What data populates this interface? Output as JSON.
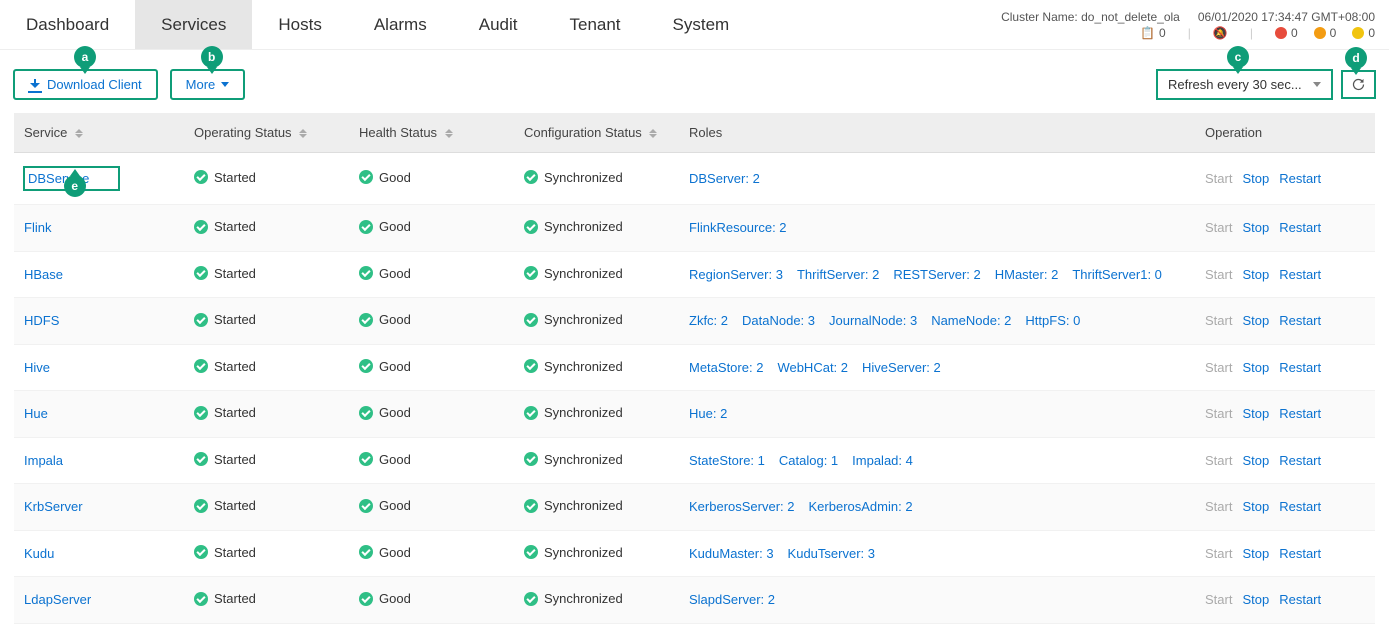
{
  "top": {
    "cluster_label": "Cluster Name:",
    "cluster_name": "do_not_delete_ola",
    "timestamp": "06/01/2020 17:34:47 GMT+08:00",
    "clipboard_count": "0",
    "red_count": "0",
    "orange_count": "0",
    "yellow_count": "0"
  },
  "nav": {
    "dashboard": "Dashboard",
    "services": "Services",
    "hosts": "Hosts",
    "alarms": "Alarms",
    "audit": "Audit",
    "tenant": "Tenant",
    "system": "System"
  },
  "toolbar": {
    "download": "Download Client",
    "more": "More",
    "refresh_select": "Refresh every 30 sec..."
  },
  "callouts": {
    "a": "a",
    "b": "b",
    "c": "c",
    "d": "d",
    "e": "e"
  },
  "columns": {
    "service": "Service",
    "operating": "Operating Status",
    "health": "Health Status",
    "config": "Configuration Status",
    "roles": "Roles",
    "operation": "Operation"
  },
  "ops": {
    "start": "Start",
    "stop": "Stop",
    "restart": "Restart"
  },
  "status": {
    "started": "Started",
    "good": "Good",
    "synchronized": "Synchronized"
  },
  "rows": [
    {
      "service": "DBService",
      "roles": [
        "DBServer: 2"
      ]
    },
    {
      "service": "Flink",
      "roles": [
        "FlinkResource: 2"
      ]
    },
    {
      "service": "HBase",
      "roles": [
        "RegionServer: 3",
        "ThriftServer: 2",
        "RESTServer: 2",
        "HMaster: 2",
        "ThriftServer1: 0"
      ]
    },
    {
      "service": "HDFS",
      "roles": [
        "Zkfc: 2",
        "DataNode: 3",
        "JournalNode: 3",
        "NameNode: 2",
        "HttpFS: 0"
      ]
    },
    {
      "service": "Hive",
      "roles": [
        "MetaStore: 2",
        "WebHCat: 2",
        "HiveServer: 2"
      ]
    },
    {
      "service": "Hue",
      "roles": [
        "Hue: 2"
      ]
    },
    {
      "service": "Impala",
      "roles": [
        "StateStore: 1",
        "Catalog: 1",
        "Impalad: 4"
      ]
    },
    {
      "service": "KrbServer",
      "roles": [
        "KerberosServer: 2",
        "KerberosAdmin: 2"
      ]
    },
    {
      "service": "Kudu",
      "roles": [
        "KuduMaster: 3",
        "KuduTserver: 3"
      ]
    },
    {
      "service": "LdapServer",
      "roles": [
        "SlapdServer: 2"
      ]
    }
  ]
}
